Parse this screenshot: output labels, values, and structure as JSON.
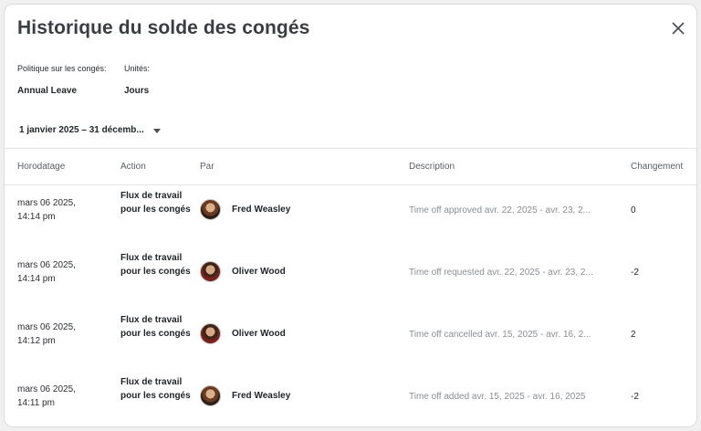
{
  "title": "Historique du solde des congés",
  "policy": {
    "label": "Politique sur les congés:",
    "value": "Annual Leave"
  },
  "units": {
    "label": "Unités:",
    "value": "Jours"
  },
  "date_range": "1 janvier 2025 – 31 décemb...",
  "headers": {
    "timestamp": "Horodatage",
    "action": "Action",
    "by": "Par",
    "description": "Description",
    "change": "Changement"
  },
  "rows": [
    {
      "time_line1": "mars 06 2025,",
      "time_line2": "14:14 pm",
      "action": "Flux de travail pour les congés",
      "by": "Fred Weasley",
      "description": "Time off approved avr. 22, 2025 - avr. 23, 2...",
      "change": "0"
    },
    {
      "time_line1": "mars 06 2025,",
      "time_line2": "14:14 pm",
      "action": "Flux de travail pour les congés",
      "by": "Oliver Wood",
      "description": "Time off requested avr. 22, 2025 - avr. 23, 2...",
      "change": "-2"
    },
    {
      "time_line1": "mars 06 2025,",
      "time_line2": "14:12 pm",
      "action": "Flux de travail pour les congés",
      "by": "Oliver Wood",
      "description": "Time off cancelled avr. 15, 2025 - avr. 16, 2...",
      "change": "2"
    },
    {
      "time_line1": "mars 06 2025,",
      "time_line2": "14:11 pm",
      "action": "Flux de travail pour les congés",
      "by": "Fred Weasley",
      "description": "Time off added avr. 15, 2025 - avr. 16, 2025",
      "change": "-2"
    }
  ]
}
